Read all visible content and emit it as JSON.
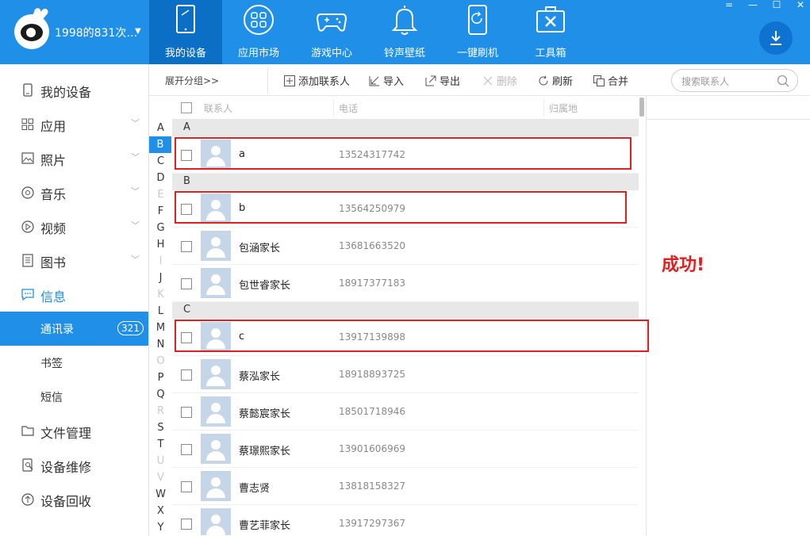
{
  "header": {
    "account_name": "1998的831次…",
    "nav": [
      {
        "label": "我的设备",
        "icon": "tablet-icon",
        "active": true
      },
      {
        "label": "应用市场",
        "icon": "apps-grid-icon",
        "active": false
      },
      {
        "label": "游戏中心",
        "icon": "gamepad-icon",
        "active": false
      },
      {
        "label": "铃声壁纸",
        "icon": "bell-icon",
        "active": false
      },
      {
        "label": "一键刷机",
        "icon": "phone-refresh-icon",
        "active": false
      },
      {
        "label": "工具箱",
        "icon": "toolbox-icon",
        "active": false
      }
    ],
    "window_controls": [
      "=",
      "—",
      "☐",
      "✕"
    ]
  },
  "sidebar": {
    "items": [
      {
        "label": "我的设备",
        "icon": "device-icon",
        "chevron": false
      },
      {
        "label": "应用",
        "icon": "apps-icon",
        "chevron": true
      },
      {
        "label": "照片",
        "icon": "photo-icon",
        "chevron": true
      },
      {
        "label": "音乐",
        "icon": "music-icon",
        "chevron": true
      },
      {
        "label": "视频",
        "icon": "video-icon",
        "chevron": true
      },
      {
        "label": "图书",
        "icon": "book-icon",
        "chevron": true
      },
      {
        "label": "信息",
        "icon": "message-icon",
        "chevron": false
      },
      {
        "label": "通讯录",
        "badge": "321",
        "selected": true
      },
      {
        "label": "书签"
      },
      {
        "label": "短信"
      },
      {
        "label": "文件管理",
        "icon": "folder-icon",
        "chevron": false
      },
      {
        "label": "设备维修",
        "icon": "repair-icon",
        "chevron": false
      },
      {
        "label": "设备回收",
        "icon": "recycle-icon",
        "chevron": false
      }
    ]
  },
  "toolbar": {
    "expand_group": "展开分组>>",
    "add_contact": "添加联系人",
    "import": "导入",
    "export": "导出",
    "delete": "删除",
    "refresh": "刷新",
    "merge": "合并",
    "search_placeholder": "搜索联系人"
  },
  "table": {
    "headers": {
      "contact": "联系人",
      "phone": "电话",
      "location": "归属地"
    },
    "alphabet": [
      {
        "letter": "A",
        "state": "normal"
      },
      {
        "letter": "B",
        "state": "selected"
      },
      {
        "letter": "C",
        "state": "normal"
      },
      {
        "letter": "D",
        "state": "normal"
      },
      {
        "letter": "E",
        "state": "off"
      },
      {
        "letter": "F",
        "state": "normal"
      },
      {
        "letter": "G",
        "state": "normal"
      },
      {
        "letter": "H",
        "state": "normal"
      },
      {
        "letter": "I",
        "state": "off"
      },
      {
        "letter": "J",
        "state": "normal"
      },
      {
        "letter": "K",
        "state": "off"
      },
      {
        "letter": "L",
        "state": "normal"
      },
      {
        "letter": "M",
        "state": "normal"
      },
      {
        "letter": "N",
        "state": "normal"
      },
      {
        "letter": "O",
        "state": "off"
      },
      {
        "letter": "P",
        "state": "normal"
      },
      {
        "letter": "Q",
        "state": "normal"
      },
      {
        "letter": "R",
        "state": "off"
      },
      {
        "letter": "S",
        "state": "normal"
      },
      {
        "letter": "T",
        "state": "normal"
      },
      {
        "letter": "U",
        "state": "off"
      },
      {
        "letter": "V",
        "state": "off"
      },
      {
        "letter": "W",
        "state": "normal"
      },
      {
        "letter": "X",
        "state": "normal"
      },
      {
        "letter": "Y",
        "state": "normal"
      }
    ],
    "groups": [
      {
        "letter": "A",
        "contacts": [
          {
            "name": "a",
            "phone": "13524317742",
            "highlighted": true
          }
        ]
      },
      {
        "letter": "B",
        "contacts": [
          {
            "name": "b",
            "phone": "13564250979",
            "highlighted": true
          },
          {
            "name": "包涵家长",
            "phone": "13681663520"
          },
          {
            "name": "包世睿家长",
            "phone": "18917377183"
          }
        ]
      },
      {
        "letter": "C",
        "contacts": [
          {
            "name": "c",
            "phone": "13917139898",
            "highlighted": true
          },
          {
            "name": "蔡泓家长",
            "phone": "18918893725"
          },
          {
            "name": "蔡懿宸家长",
            "phone": "18501718946"
          },
          {
            "name": "蔡璟熙家长",
            "phone": "13901606969"
          },
          {
            "name": "曹志贤",
            "phone": "13818158327"
          },
          {
            "name": "曹艺菲家长",
            "phone": "13917297367"
          }
        ]
      }
    ]
  },
  "annotation": {
    "text": "成功!"
  },
  "colors": {
    "accent": "#1f8fe8",
    "nav_active": "#0c6fc6",
    "highlight": "#e02020"
  }
}
